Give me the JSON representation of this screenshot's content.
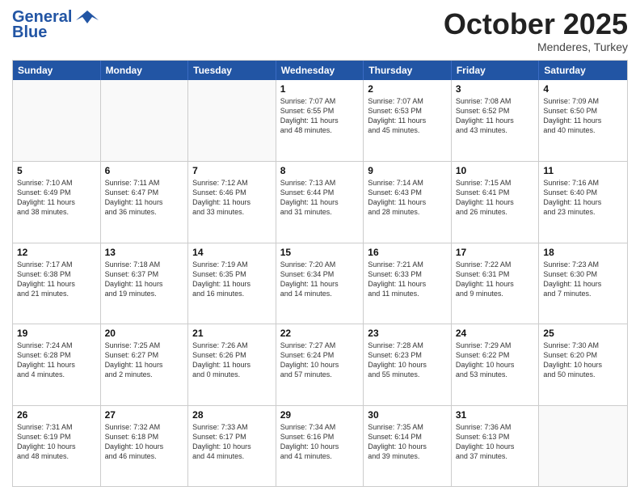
{
  "header": {
    "logo_line1": "General",
    "logo_line2": "Blue",
    "month": "October 2025",
    "location": "Menderes, Turkey"
  },
  "weekdays": [
    "Sunday",
    "Monday",
    "Tuesday",
    "Wednesday",
    "Thursday",
    "Friday",
    "Saturday"
  ],
  "weeks": [
    [
      {
        "day": "",
        "info": ""
      },
      {
        "day": "",
        "info": ""
      },
      {
        "day": "",
        "info": ""
      },
      {
        "day": "1",
        "info": "Sunrise: 7:07 AM\nSunset: 6:55 PM\nDaylight: 11 hours\nand 48 minutes."
      },
      {
        "day": "2",
        "info": "Sunrise: 7:07 AM\nSunset: 6:53 PM\nDaylight: 11 hours\nand 45 minutes."
      },
      {
        "day": "3",
        "info": "Sunrise: 7:08 AM\nSunset: 6:52 PM\nDaylight: 11 hours\nand 43 minutes."
      },
      {
        "day": "4",
        "info": "Sunrise: 7:09 AM\nSunset: 6:50 PM\nDaylight: 11 hours\nand 40 minutes."
      }
    ],
    [
      {
        "day": "5",
        "info": "Sunrise: 7:10 AM\nSunset: 6:49 PM\nDaylight: 11 hours\nand 38 minutes."
      },
      {
        "day": "6",
        "info": "Sunrise: 7:11 AM\nSunset: 6:47 PM\nDaylight: 11 hours\nand 36 minutes."
      },
      {
        "day": "7",
        "info": "Sunrise: 7:12 AM\nSunset: 6:46 PM\nDaylight: 11 hours\nand 33 minutes."
      },
      {
        "day": "8",
        "info": "Sunrise: 7:13 AM\nSunset: 6:44 PM\nDaylight: 11 hours\nand 31 minutes."
      },
      {
        "day": "9",
        "info": "Sunrise: 7:14 AM\nSunset: 6:43 PM\nDaylight: 11 hours\nand 28 minutes."
      },
      {
        "day": "10",
        "info": "Sunrise: 7:15 AM\nSunset: 6:41 PM\nDaylight: 11 hours\nand 26 minutes."
      },
      {
        "day": "11",
        "info": "Sunrise: 7:16 AM\nSunset: 6:40 PM\nDaylight: 11 hours\nand 23 minutes."
      }
    ],
    [
      {
        "day": "12",
        "info": "Sunrise: 7:17 AM\nSunset: 6:38 PM\nDaylight: 11 hours\nand 21 minutes."
      },
      {
        "day": "13",
        "info": "Sunrise: 7:18 AM\nSunset: 6:37 PM\nDaylight: 11 hours\nand 19 minutes."
      },
      {
        "day": "14",
        "info": "Sunrise: 7:19 AM\nSunset: 6:35 PM\nDaylight: 11 hours\nand 16 minutes."
      },
      {
        "day": "15",
        "info": "Sunrise: 7:20 AM\nSunset: 6:34 PM\nDaylight: 11 hours\nand 14 minutes."
      },
      {
        "day": "16",
        "info": "Sunrise: 7:21 AM\nSunset: 6:33 PM\nDaylight: 11 hours\nand 11 minutes."
      },
      {
        "day": "17",
        "info": "Sunrise: 7:22 AM\nSunset: 6:31 PM\nDaylight: 11 hours\nand 9 minutes."
      },
      {
        "day": "18",
        "info": "Sunrise: 7:23 AM\nSunset: 6:30 PM\nDaylight: 11 hours\nand 7 minutes."
      }
    ],
    [
      {
        "day": "19",
        "info": "Sunrise: 7:24 AM\nSunset: 6:28 PM\nDaylight: 11 hours\nand 4 minutes."
      },
      {
        "day": "20",
        "info": "Sunrise: 7:25 AM\nSunset: 6:27 PM\nDaylight: 11 hours\nand 2 minutes."
      },
      {
        "day": "21",
        "info": "Sunrise: 7:26 AM\nSunset: 6:26 PM\nDaylight: 11 hours\nand 0 minutes."
      },
      {
        "day": "22",
        "info": "Sunrise: 7:27 AM\nSunset: 6:24 PM\nDaylight: 10 hours\nand 57 minutes."
      },
      {
        "day": "23",
        "info": "Sunrise: 7:28 AM\nSunset: 6:23 PM\nDaylight: 10 hours\nand 55 minutes."
      },
      {
        "day": "24",
        "info": "Sunrise: 7:29 AM\nSunset: 6:22 PM\nDaylight: 10 hours\nand 53 minutes."
      },
      {
        "day": "25",
        "info": "Sunrise: 7:30 AM\nSunset: 6:20 PM\nDaylight: 10 hours\nand 50 minutes."
      }
    ],
    [
      {
        "day": "26",
        "info": "Sunrise: 7:31 AM\nSunset: 6:19 PM\nDaylight: 10 hours\nand 48 minutes."
      },
      {
        "day": "27",
        "info": "Sunrise: 7:32 AM\nSunset: 6:18 PM\nDaylight: 10 hours\nand 46 minutes."
      },
      {
        "day": "28",
        "info": "Sunrise: 7:33 AM\nSunset: 6:17 PM\nDaylight: 10 hours\nand 44 minutes."
      },
      {
        "day": "29",
        "info": "Sunrise: 7:34 AM\nSunset: 6:16 PM\nDaylight: 10 hours\nand 41 minutes."
      },
      {
        "day": "30",
        "info": "Sunrise: 7:35 AM\nSunset: 6:14 PM\nDaylight: 10 hours\nand 39 minutes."
      },
      {
        "day": "31",
        "info": "Sunrise: 7:36 AM\nSunset: 6:13 PM\nDaylight: 10 hours\nand 37 minutes."
      },
      {
        "day": "",
        "info": ""
      }
    ]
  ]
}
